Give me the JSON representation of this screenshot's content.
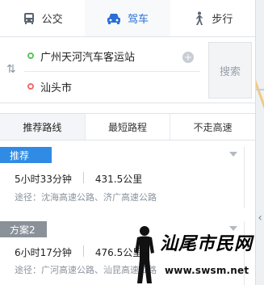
{
  "mode_tabs": [
    {
      "label": "公交",
      "icon": "bus-icon",
      "active": false
    },
    {
      "label": "驾车",
      "icon": "car-icon",
      "active": true
    },
    {
      "label": "步行",
      "icon": "walk-icon",
      "active": false
    }
  ],
  "route_input": {
    "start": "广州天河汽车客运站",
    "end": "汕头市",
    "search_label": "搜索"
  },
  "route_tabs": [
    {
      "label": "推荐路线",
      "active": true
    },
    {
      "label": "最短路程",
      "active": false
    },
    {
      "label": "不走高速",
      "active": false
    }
  ],
  "routes": [
    {
      "badge": "推荐",
      "badge_color": "#2f8be3",
      "duration": "5小时33分钟",
      "distance": "431.5公里",
      "via": "途径：沈海高速公路、济广高速公路"
    },
    {
      "badge": "方案2",
      "badge_color": "#8a9199",
      "duration": "6小时17分钟",
      "distance": "476.5公里",
      "via": "途径：广河高速公路、汕昆高速公路"
    }
  ],
  "watermark": {
    "title": "汕尾市民网",
    "url": "www.swsm.net"
  },
  "colors": {
    "accent": "#2b6fd6",
    "start_dot": "#59c45b",
    "end_dot": "#f06b6b"
  }
}
